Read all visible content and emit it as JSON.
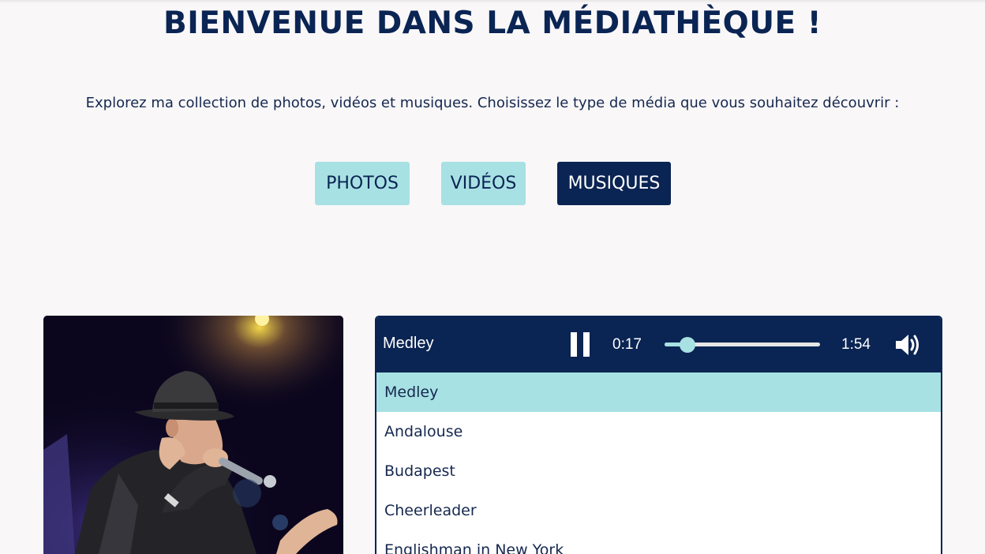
{
  "page": {
    "title": "BIENVENUE DANS LA MÉDIATHÈQUE !",
    "intro": "Explorez ma collection de photos, vidéos et musiques. Choisissez le type de média que vous souhaitez découvrir :"
  },
  "media_types": {
    "photos": "PHOTOS",
    "videos": "VIDÉOS",
    "music": "MUSIQUES",
    "selected": "MUSIQUES"
  },
  "player": {
    "now_playing": "Medley",
    "current_time": "0:17",
    "duration": "1:54",
    "progress_fraction": 0.147,
    "state": "playing",
    "pause_icon": "pause-icon",
    "volume_icon": "volume-icon"
  },
  "tracks": [
    {
      "label": "Medley",
      "active": true
    },
    {
      "label": "Andalouse",
      "active": false
    },
    {
      "label": "Budapest",
      "active": false
    },
    {
      "label": "Cheerleader",
      "active": false
    },
    {
      "label": "Englishman in New York",
      "active": false
    }
  ],
  "colors": {
    "navy": "#0a2453",
    "accent": "#a8e1e3",
    "background": "#f9f7f8"
  }
}
